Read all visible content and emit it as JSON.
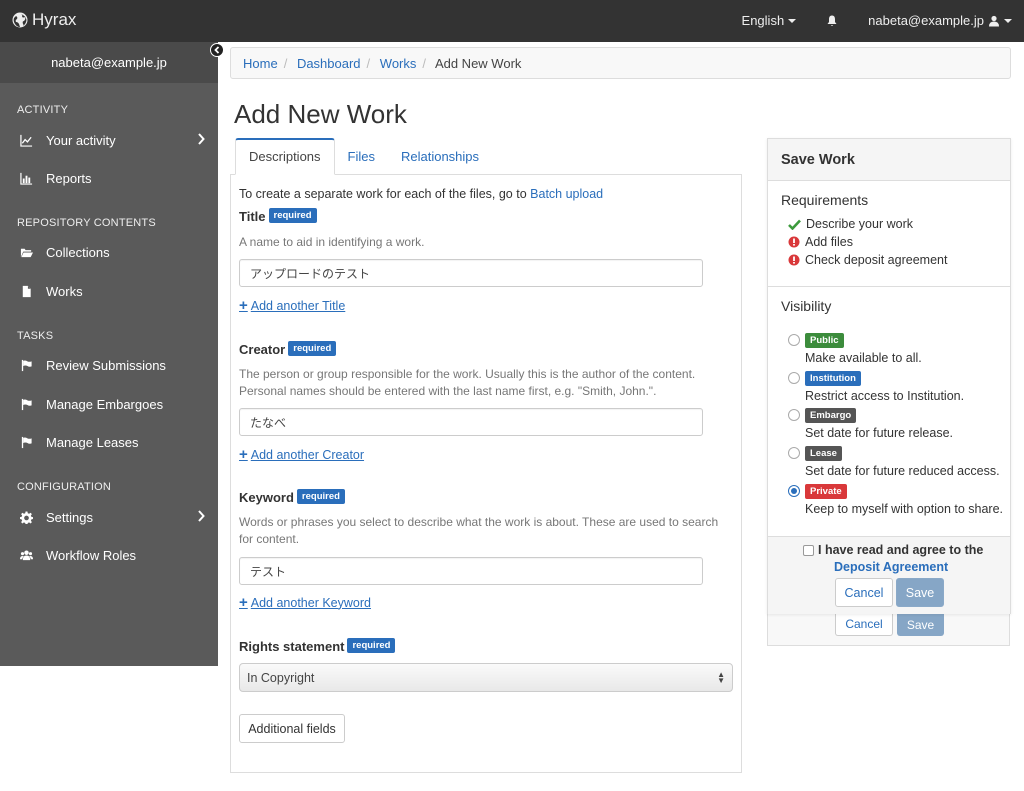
{
  "navbar": {
    "brand": "Hyrax",
    "language": "English",
    "user": "nabeta@example.jp"
  },
  "sidebar": {
    "user": "nabeta@example.jp",
    "sections": {
      "activity": "ACTIVITY",
      "repository": "REPOSITORY CONTENTS",
      "tasks": "TASKS",
      "configuration": "CONFIGURATION"
    },
    "items": {
      "your_activity": "Your activity",
      "reports": "Reports",
      "collections": "Collections",
      "works": "Works",
      "review": "Review Submissions",
      "embargoes": "Manage Embargoes",
      "leases": "Manage Leases",
      "settings": "Settings",
      "workflow": "Workflow Roles"
    }
  },
  "breadcrumb": {
    "home": "Home",
    "dashboard": "Dashboard",
    "works": "Works",
    "current": "Add New Work"
  },
  "page_title": "Add New Work",
  "tabs": {
    "descriptions": "Descriptions",
    "files": "Files",
    "relationships": "Relationships"
  },
  "form": {
    "batch_text": "To create a separate work for each of the files, go to",
    "batch_link": "Batch upload",
    "required_badge": "required",
    "title_label": "Title",
    "title_help": "A name to aid in identifying a work.",
    "title_value": "アップロードのテスト",
    "add_title": "Add another Title",
    "creator_label": "Creator",
    "creator_help": "The person or group responsible for the work. Usually this is the author of the content. Personal names should be entered with the last name first, e.g. \"Smith, John.\".",
    "creator_value": "たなべ",
    "add_creator": "Add another Creator",
    "keyword_label": "Keyword",
    "keyword_help": "Words or phrases you select to describe what the work is about. These are used to search for content.",
    "keyword_value": "テスト",
    "add_keyword": "Add another Keyword",
    "rights_label": "Rights statement",
    "rights_value": "In Copyright",
    "additional_fields": "Additional fields"
  },
  "save_panel": {
    "title": "Save Work",
    "requirements_heading": "Requirements",
    "requirements": {
      "describe": "Describe your work",
      "files": "Add files",
      "deposit": "Check deposit agreement"
    },
    "visibility_heading": "Visibility",
    "visibility": {
      "public": {
        "badge": "Public",
        "desc": "Make available to all.",
        "color": "#3c8c3c"
      },
      "institution": {
        "badge": "Institution",
        "desc": "Restrict access to Institution.",
        "color": "#2a6ebb"
      },
      "embargo": {
        "badge": "Embargo",
        "desc": "Set date for future release.",
        "color": "#555555"
      },
      "lease": {
        "badge": "Lease",
        "desc": "Set date for future reduced access.",
        "color": "#555555"
      },
      "private": {
        "badge": "Private",
        "desc": "Keep to myself with option to share.",
        "color": "#d9383a"
      }
    },
    "agreement_text": "I have read and agree to the",
    "agreement_link": "Deposit Agreement",
    "cancel": "Cancel",
    "save": "Save"
  }
}
